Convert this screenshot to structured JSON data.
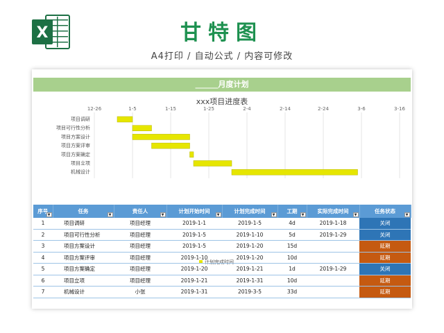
{
  "header": {
    "title": "甘特图",
    "subtitle": "A4打印 / 自动公式 / 内容可修改",
    "logo_letter": "X"
  },
  "sheet": {
    "banner": "______月度计划"
  },
  "chart_data": {
    "type": "bar",
    "title": "xxx项目进度表",
    "x_ticks": [
      "12-26",
      "1-5",
      "1-15",
      "1-25",
      "2-4",
      "2-14",
      "2-24",
      "3-6",
      "3-16"
    ],
    "xlim": [
      "2018-12-26",
      "2019-03-16"
    ],
    "categories": [
      "项目调研",
      "项目可行性分析",
      "项目方案设计",
      "项目方案评审",
      "项目方案确定",
      "项目立项",
      "机械设计"
    ],
    "series": [
      {
        "name": "计划完成时间",
        "start": [
          "2019-01-01",
          "2019-01-05",
          "2019-01-05",
          "2019-01-10",
          "2019-01-20",
          "2019-01-21",
          "2019-01-31"
        ],
        "end": [
          "2019-01-05",
          "2019-01-10",
          "2019-01-20",
          "2019-01-20",
          "2019-01-21",
          "2019-01-31",
          "2019-03-05"
        ]
      }
    ],
    "legend_position": "bottom",
    "grid": true,
    "colors": {
      "bar": "#e6e600",
      "bar_dark": "#b5b500"
    }
  },
  "table": {
    "headers": [
      "序号",
      "任务",
      "责任人",
      "计划开始时间",
      "计划完成时间",
      "工期",
      "实际完成时间",
      "任务状态"
    ],
    "rows": [
      {
        "no": "1",
        "task": "项目调研",
        "owner": "项目经理",
        "plan_start": "2019-1-1",
        "plan_end": "2019-1-5",
        "duration": "4d",
        "actual_end": "2019-1-18",
        "status": "关闭",
        "status_type": "closed"
      },
      {
        "no": "2",
        "task": "项目可行性分析",
        "owner": "项目经理",
        "plan_start": "2019-1-5",
        "plan_end": "2019-1-10",
        "duration": "5d",
        "actual_end": "2019-1-29",
        "status": "关闭",
        "status_type": "closed"
      },
      {
        "no": "3",
        "task": "项目方案设计",
        "owner": "项目经理",
        "plan_start": "2019-1-5",
        "plan_end": "2019-1-20",
        "duration": "15d",
        "actual_end": "",
        "status": "延期",
        "status_type": "delayed"
      },
      {
        "no": "4",
        "task": "项目方案评审",
        "owner": "项目经理",
        "plan_start": "2019-1-10",
        "plan_end": "2019-1-20",
        "duration": "10d",
        "actual_end": "",
        "status": "延期",
        "status_type": "delayed"
      },
      {
        "no": "5",
        "task": "项目方案确定",
        "owner": "项目经理",
        "plan_start": "2019-1-20",
        "plan_end": "2019-1-21",
        "duration": "1d",
        "actual_end": "2019-1-29",
        "status": "关闭",
        "status_type": "closed"
      },
      {
        "no": "6",
        "task": "项目立项",
        "owner": "项目经理",
        "plan_start": "2019-1-21",
        "plan_end": "2019-1-31",
        "duration": "10d",
        "actual_end": "",
        "status": "延期",
        "status_type": "delayed"
      },
      {
        "no": "7",
        "task": "机械设计",
        "owner": "小张",
        "plan_start": "2019-1-31",
        "plan_end": "2019-3-5",
        "duration": "33d",
        "actual_end": "",
        "status": "延期",
        "status_type": "delayed"
      }
    ]
  }
}
